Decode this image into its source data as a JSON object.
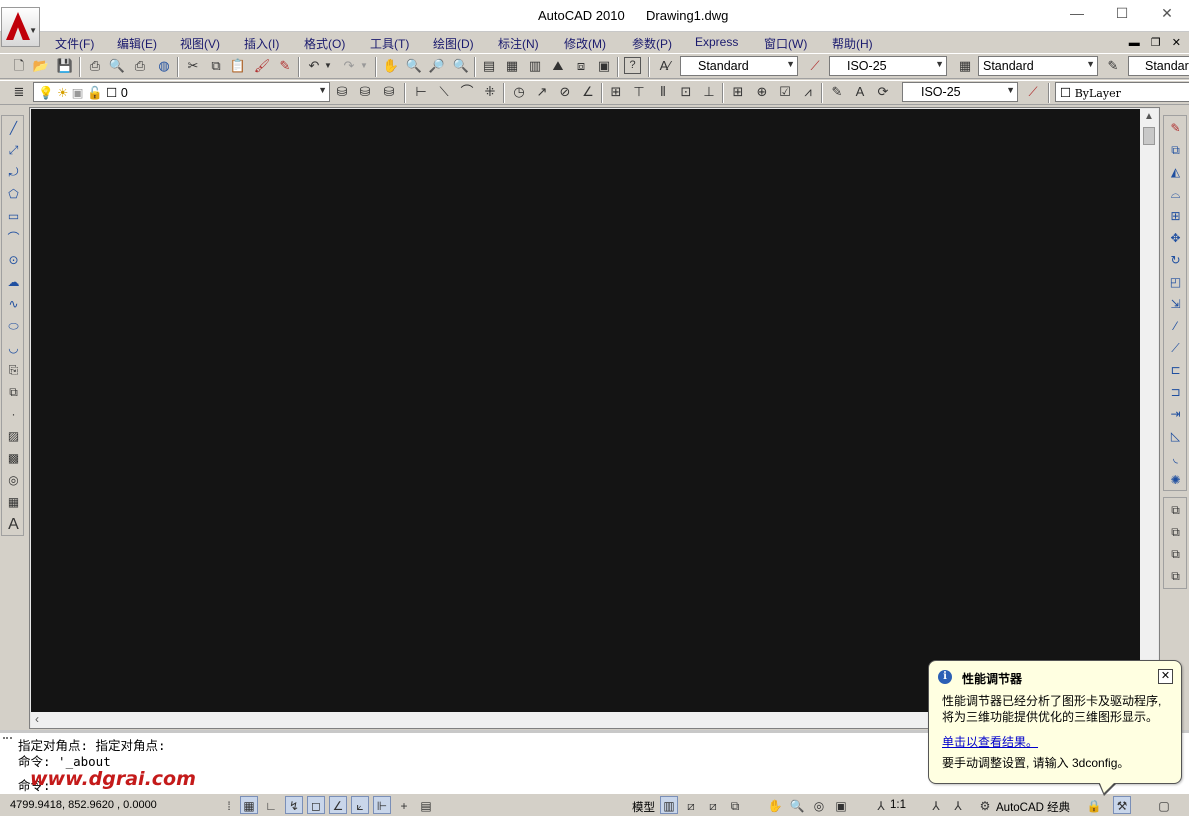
{
  "window": {
    "app_title": "AutoCAD 2010",
    "file_name": "Drawing1.dwg",
    "minimize": "—",
    "maximize": "☐",
    "close": "✕"
  },
  "menu": [
    {
      "label": "文件(F)"
    },
    {
      "label": "编辑(E)"
    },
    {
      "label": "视图(V)"
    },
    {
      "label": "插入(I)"
    },
    {
      "label": "格式(O)"
    },
    {
      "label": "工具(T)"
    },
    {
      "label": "绘图(D)"
    },
    {
      "label": "标注(N)"
    },
    {
      "label": "修改(M)"
    },
    {
      "label": "参数(P)"
    },
    {
      "label": "Express"
    },
    {
      "label": "窗口(W)"
    },
    {
      "label": "帮助(H)"
    }
  ],
  "mdi_controls": "▬ ❐ ✕",
  "styles_toolbar": {
    "text_style": "Standard",
    "dim_style": "ISO-25",
    "table_style": "Standard",
    "multileader_style": "Standar"
  },
  "layers_toolbar": {
    "current_layer": "0",
    "dim_style": "ISO-25",
    "color": "ByLayer"
  },
  "command_line": {
    "line1": "指定对角点: 指定对角点:",
    "line2": "命令: '_about",
    "line3": "命令:"
  },
  "watermark": "www.dgrai.com",
  "status_bar": {
    "coordinates": "4799.9418,  852.9620 ,  0.0000",
    "model_label": "模型",
    "annotation_scale": "1:1",
    "workspace": "AutoCAD 经典"
  },
  "balloon": {
    "title": "性能调节器",
    "body_line1": "性能调节器已经分析了图形卡及驱动程序,",
    "body_line2": "将为三维功能提供优化的三维图形显示。",
    "link": "单击以查看结果。",
    "footer": "要手动调整设置, 请输入 3dconfig。",
    "close": "✕"
  }
}
